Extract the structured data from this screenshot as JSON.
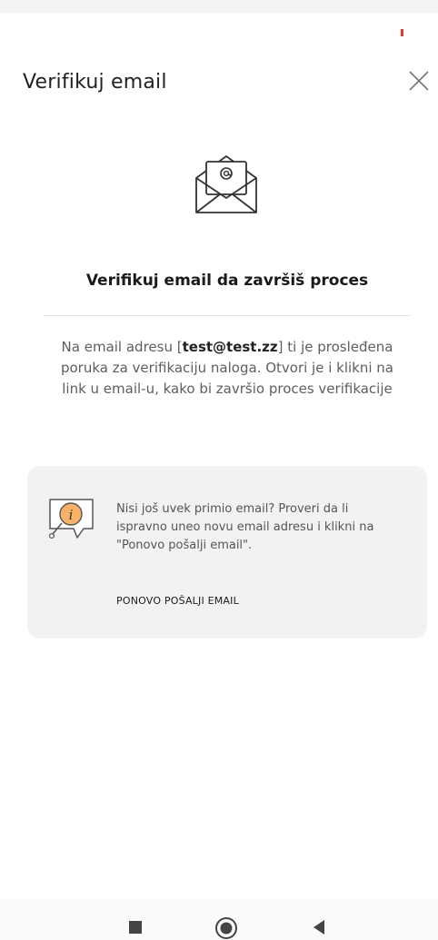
{
  "header": {
    "title": "Verifikuj email"
  },
  "main": {
    "headline": "Verifikuj email da završiš proces",
    "description": {
      "prefix": "Na email adresu [",
      "email": "test@test.zz",
      "suffix": "] ti je prosleđena poruka za verifikaciju naloga. Otvori je i klikni na link u email-u, kako bi završio proces verifikacije"
    }
  },
  "info": {
    "text": "Nisi još uvek primio email? Proveri da li ispravno uneo novu email adresu i klikni na \"Ponovo pošalji email\".",
    "resend_label": "PONOVO POŠALJI EMAIL"
  },
  "colors": {
    "accent": "#f7b267",
    "status_red": "#e53935",
    "card_bg": "#f2f2f2"
  },
  "icons": {
    "close": "close-icon",
    "envelope": "envelope-at-icon",
    "info": "info-bubble-icon",
    "nav": [
      "nav-square-icon",
      "nav-circle-icon",
      "nav-back-icon"
    ]
  }
}
